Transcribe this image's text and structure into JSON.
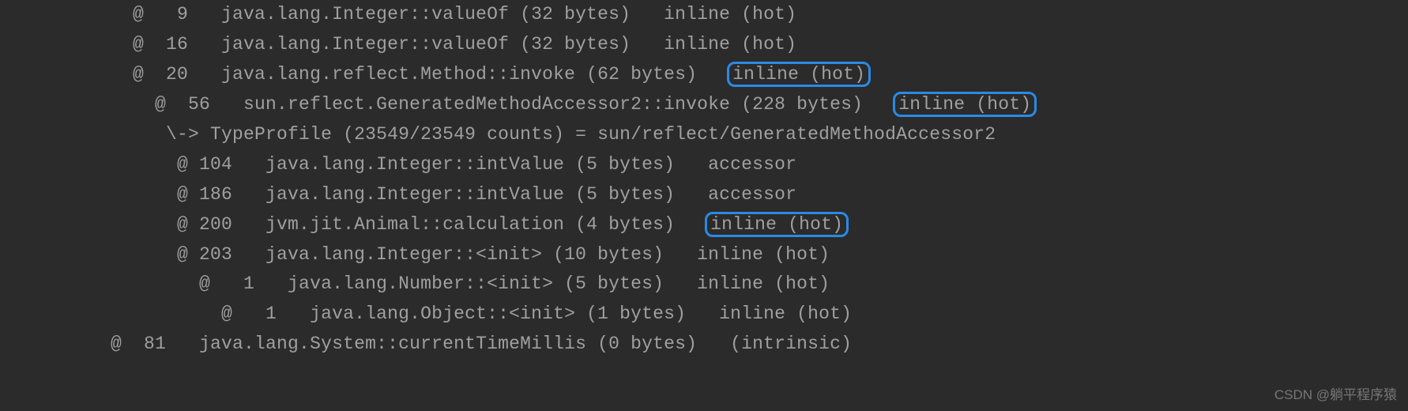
{
  "lines": [
    {
      "indent": 12,
      "bci": "9",
      "method": "java.lang.Integer::valueOf",
      "size": "(32 bytes)",
      "status": "inline (hot)",
      "hl": false
    },
    {
      "indent": 12,
      "bci": "16",
      "method": "java.lang.Integer::valueOf",
      "size": "(32 bytes)",
      "status": "inline (hot)",
      "hl": false
    },
    {
      "indent": 12,
      "bci": "20",
      "method": "java.lang.reflect.Method::invoke",
      "size": "(62 bytes)",
      "status": "inline (hot)",
      "hl": true
    },
    {
      "indent": 14,
      "bci": "56",
      "method": "sun.reflect.GeneratedMethodAccessor2::invoke",
      "size": "(228 bytes)",
      "status": "inline (hot)",
      "hl": true
    },
    {
      "indent": 15,
      "raw": "\\-> TypeProfile (23549/23549 counts) = sun/reflect/GeneratedMethodAccessor2"
    },
    {
      "indent": 16,
      "bci": "104",
      "method": "java.lang.Integer::intValue",
      "size": "(5 bytes)",
      "status": "accessor",
      "hl": false
    },
    {
      "indent": 16,
      "bci": "186",
      "method": "java.lang.Integer::intValue",
      "size": "(5 bytes)",
      "status": "accessor",
      "hl": false
    },
    {
      "indent": 16,
      "bci": "200",
      "method": "jvm.jit.Animal::calculation",
      "size": "(4 bytes)",
      "status": "inline (hot)",
      "hl": true
    },
    {
      "indent": 16,
      "bci": "203",
      "method": "java.lang.Integer::<init>",
      "size": "(10 bytes)",
      "status": "inline (hot)",
      "hl": false
    },
    {
      "indent": 18,
      "bci": "1",
      "method": "java.lang.Number::<init>",
      "size": "(5 bytes)",
      "status": "inline (hot)",
      "hl": false
    },
    {
      "indent": 20,
      "bci": "1",
      "method": "java.lang.Object::<init>",
      "size": "(1 bytes)",
      "status": "inline (hot)",
      "hl": false
    },
    {
      "indent": 10,
      "bci": "81",
      "method": "java.lang.System::currentTimeMillis",
      "size": "(0 bytes)",
      "status": "(intrinsic)",
      "hl": false
    }
  ],
  "watermark": "CSDN @躺平程序猿"
}
